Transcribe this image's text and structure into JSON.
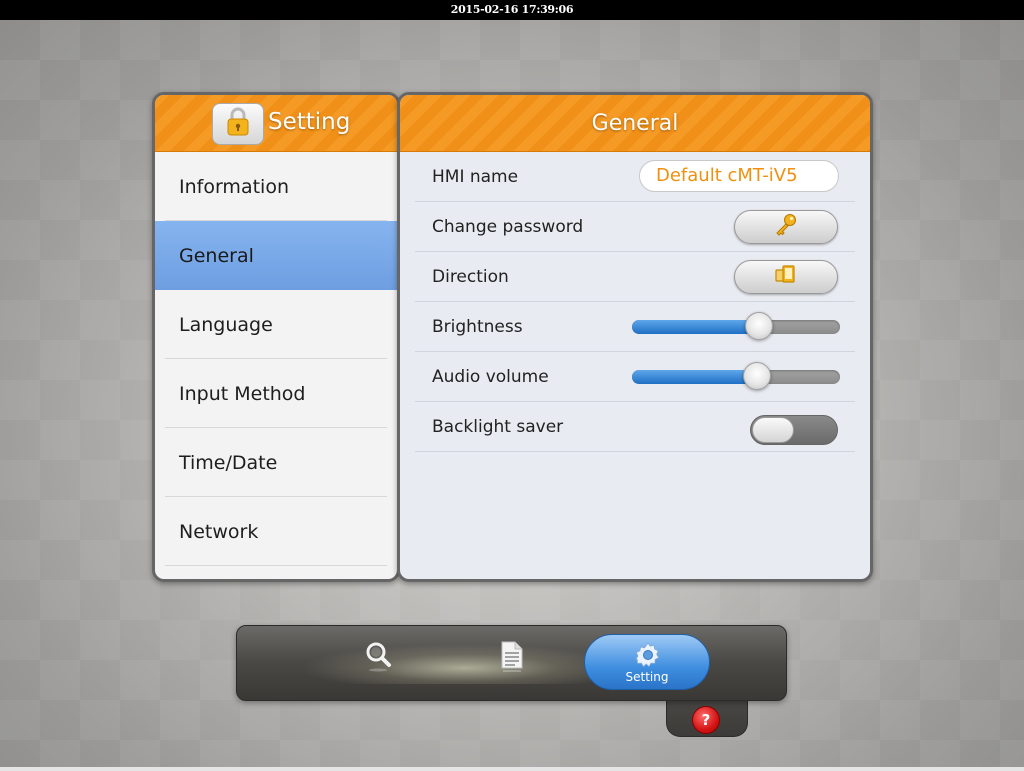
{
  "status_bar": {
    "datetime": "2015-02-16 17:39:06"
  },
  "sidebar": {
    "title": "Setting",
    "items": [
      {
        "label": "Information",
        "active": false
      },
      {
        "label": "General",
        "active": true
      },
      {
        "label": "Language",
        "active": false
      },
      {
        "label": "Input Method",
        "active": false
      },
      {
        "label": "Time/Date",
        "active": false
      },
      {
        "label": "Network",
        "active": false
      }
    ]
  },
  "main": {
    "title": "General",
    "rows": {
      "hmi_name": {
        "label": "HMI name",
        "value": "Default cMT-iV5"
      },
      "change_password": {
        "label": "Change password",
        "icon": "key-icon"
      },
      "direction": {
        "label": "Direction",
        "icon": "rotate-screen-icon"
      },
      "brightness": {
        "label": "Brightness",
        "level_percent": 61
      },
      "audio_volume": {
        "label": "Audio volume",
        "level_percent": 60
      },
      "backlight_saver": {
        "label": "Backlight saver",
        "enabled": false
      }
    }
  },
  "dock": {
    "items": [
      {
        "icon": "search-icon"
      },
      {
        "icon": "document-icon"
      },
      {
        "icon": "gear-icon",
        "label": "Setting",
        "active": true
      }
    ],
    "help_icon": "help-icon",
    "help_glyph": "?"
  },
  "colors": {
    "header_orange": "#f59a25",
    "active_blue": "#7aa9e8",
    "value_orange": "#f0900e",
    "slider_blue": "#1f6fc4"
  }
}
